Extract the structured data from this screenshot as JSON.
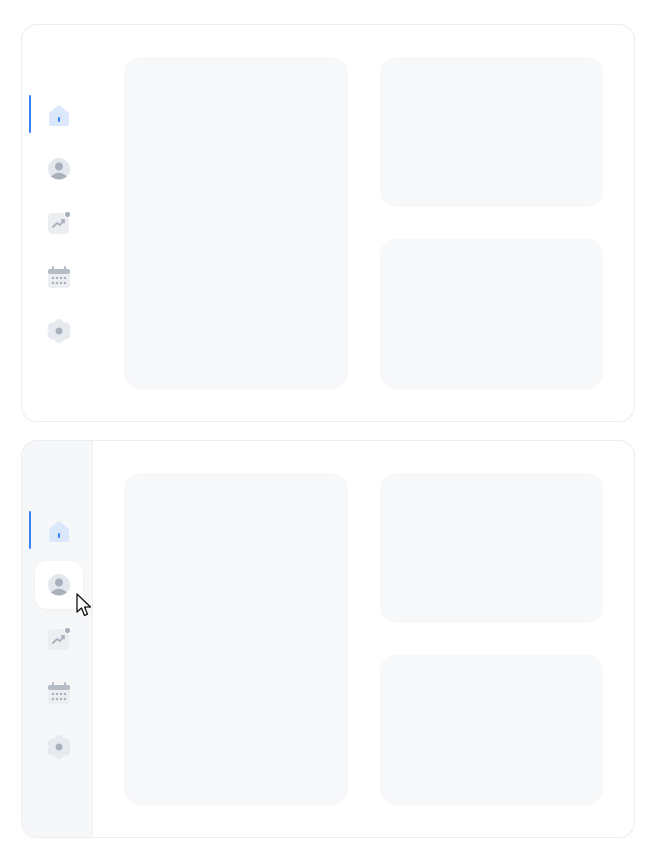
{
  "colors": {
    "accent": "#3b82f6",
    "active_icon_bg": "#dbe7fb",
    "icon_gray": "#b6bcc6",
    "icon_light": "#d9dde3",
    "card_bg": "#f7f8fa",
    "sidebar_bg_panel2": "#f6f7f9"
  },
  "panels": [
    {
      "state": "default",
      "active_item": "home",
      "nav_items": [
        {
          "id": "home",
          "icon": "home-icon",
          "active": true
        },
        {
          "id": "profile",
          "icon": "user-icon",
          "active": false
        },
        {
          "id": "analytics",
          "icon": "trending-chart-icon",
          "active": false,
          "notification_dot": true
        },
        {
          "id": "calendar",
          "icon": "calendar-icon",
          "active": false
        },
        {
          "id": "settings",
          "icon": "flower-settings-icon",
          "active": false
        }
      ],
      "content_cards": [
        "card-large",
        "card-top-right",
        "card-bottom-right"
      ]
    },
    {
      "state": "hover",
      "active_item": "home",
      "hovered_item": "profile",
      "nav_items": [
        {
          "id": "home",
          "icon": "home-icon",
          "active": true
        },
        {
          "id": "profile",
          "icon": "user-icon",
          "active": false,
          "hovered": true
        },
        {
          "id": "analytics",
          "icon": "trending-chart-icon",
          "active": false,
          "notification_dot": true
        },
        {
          "id": "calendar",
          "icon": "calendar-icon",
          "active": false
        },
        {
          "id": "settings",
          "icon": "flower-settings-icon",
          "active": false
        }
      ],
      "content_cards": [
        "card-large",
        "card-top-right",
        "card-bottom-right"
      ]
    }
  ]
}
